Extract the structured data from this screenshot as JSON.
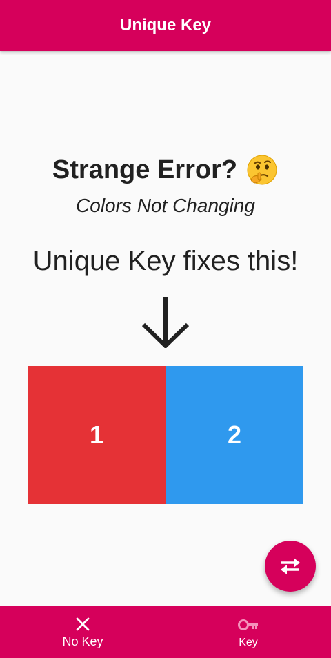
{
  "app_bar": {
    "title": "Unique Key"
  },
  "content": {
    "headline": "Strange Error?",
    "headline_emoji": "thinking-face-icon",
    "subtitle": "Colors Not Changing",
    "fix_text": "Unique Key fixes this!",
    "arrow": "arrow-down-icon"
  },
  "tiles": [
    {
      "label": "1",
      "color": "#e53236"
    },
    {
      "label": "2",
      "color": "#2f99ee"
    }
  ],
  "fab": {
    "icon": "swap-icon"
  },
  "bottom_nav": {
    "items": [
      {
        "label": "No Key",
        "icon": "close-icon",
        "selected": true
      },
      {
        "label": "Key",
        "icon": "key-icon",
        "selected": false
      }
    ]
  },
  "colors": {
    "primary": "#d6005b",
    "background": "#fafafa",
    "text": "#212121"
  }
}
